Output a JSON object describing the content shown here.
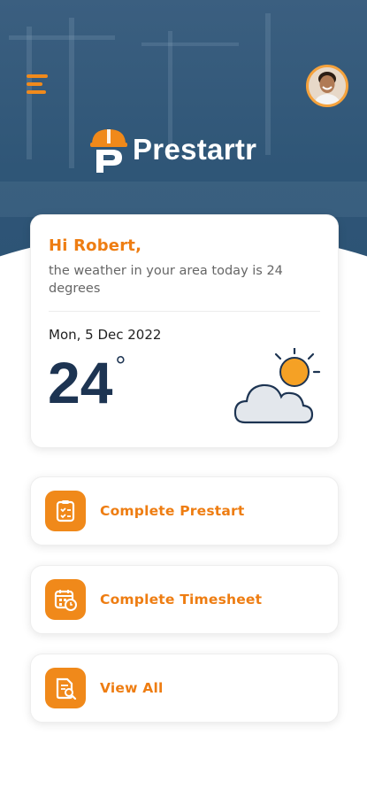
{
  "header": {
    "app_name": "Prestartr",
    "menu_icon": "hamburger-menu-icon",
    "avatar_icon": "user-avatar"
  },
  "weather_card": {
    "greeting": "Hi Robert,",
    "message": "the weather in your area today is 24 degrees",
    "date": "Mon, 5 Dec 2022",
    "temperature": "24",
    "degree_symbol": "°",
    "condition_icon": "partly-cloudy-icon"
  },
  "actions": [
    {
      "label": "Complete Prestart",
      "icon": "clipboard-checklist-icon"
    },
    {
      "label": "Complete Timesheet",
      "icon": "calendar-clock-icon"
    },
    {
      "label": "View All",
      "icon": "document-search-icon"
    }
  ],
  "colors": {
    "accent": "#f0891a",
    "header_bg": "#2f5677",
    "temperature_text": "#1d3452"
  }
}
